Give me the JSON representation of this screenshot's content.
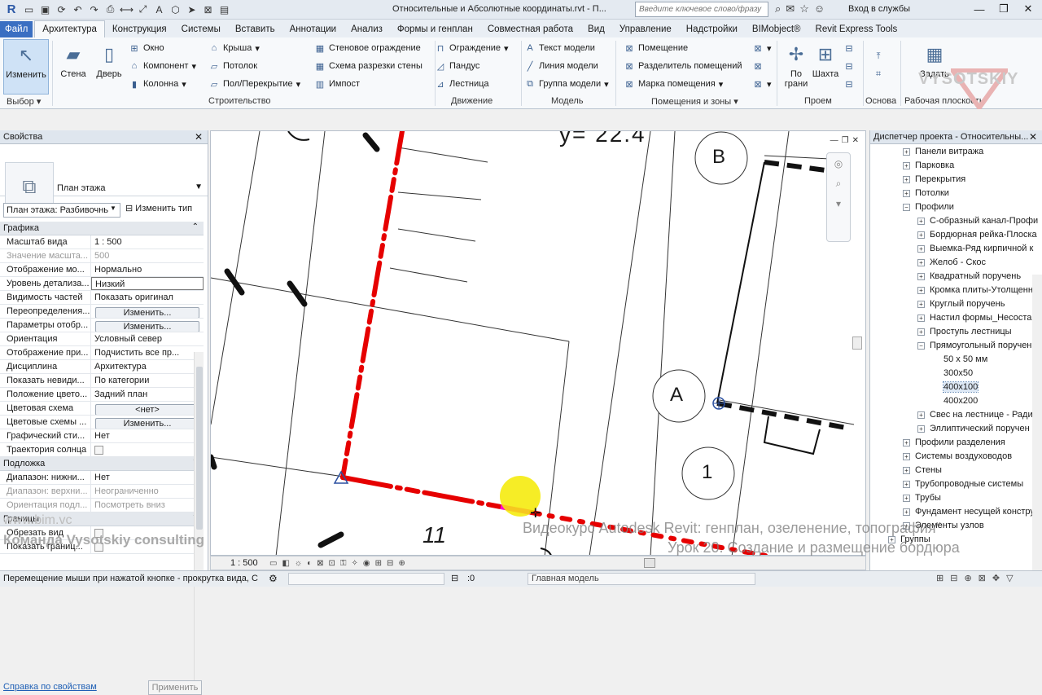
{
  "titlebar": {
    "logo": "R",
    "document_title": "Относительные и Абсолютные координаты.rvt - П...",
    "search_placeholder": "Введите ключевое слово/фразу",
    "signin": "Вход в службы"
  },
  "tabs": [
    "Файл",
    "Архитектура",
    "Конструкция",
    "Системы",
    "Вставить",
    "Аннотации",
    "Анализ",
    "Формы и генплан",
    "Совместная работа",
    "Вид",
    "Управление",
    "Надстройки",
    "BIMobject®",
    "Revit Express Tools"
  ],
  "ribbon": {
    "modify": "Изменить",
    "wall": "Стена",
    "door": "Дверь",
    "window": "Окно",
    "component": "Компонент",
    "column": "Колонна",
    "roof": "Крыша",
    "ceiling": "Потолок",
    "floor": "Пол/Перекрытие",
    "curtain_wall": "Стеновое ограждение",
    "curtain_grid": "Схема разрезки стены",
    "mullion": "Импост",
    "railing": "Ограждение",
    "ramp": "Пандус",
    "stair": "Лестница",
    "model_text": "Текст модели",
    "model_line": "Линия модели",
    "model_group": "Группа модели",
    "room": "Помещение",
    "room_sep": "Разделитель помещений",
    "room_tag": "Марка помещения",
    "by_face": "По грани",
    "shaft": "Шахта",
    "set": "Задать",
    "groups": {
      "select": "Выбор",
      "build": "Строительство",
      "circulation": "Движение",
      "model": "Модель",
      "rooms": "Помещения и зоны",
      "opening": "Проем",
      "datum": "Основа",
      "workplane": "Рабочая плоскость"
    },
    "watermark": "VYSOTSKIY"
  },
  "properties": {
    "title": "Свойства",
    "type_name": "План этажа",
    "view_selector": "План этажа: Разбивочнь",
    "edit_type": "Изменить тип",
    "sections": {
      "graphics": "Графика",
      "underlay": "Подложка",
      "extents": "Границы"
    },
    "rows": [
      {
        "k": "Масштаб вида",
        "v": "1 : 500"
      },
      {
        "k": "Значение масшта...",
        "v": "500",
        "dim": true
      },
      {
        "k": "Отображение мо...",
        "v": "Нормально"
      },
      {
        "k": "Уровень детализа...",
        "v": "Низкий"
      },
      {
        "k": "Видимость частей",
        "v": "Показать оригинал"
      },
      {
        "k": "Переопределения...",
        "btn": "Изменить..."
      },
      {
        "k": "Параметры отобр...",
        "btn": "Изменить..."
      },
      {
        "k": "Ориентация",
        "v": "Условный север"
      },
      {
        "k": "Отображение при...",
        "v": "Подчистить все пр..."
      },
      {
        "k": "Дисциплина",
        "v": "Архитектура"
      },
      {
        "k": "Показать невиди...",
        "v": "По категории"
      },
      {
        "k": "Положение цвето...",
        "v": "Задний план"
      },
      {
        "k": "Цветовая схема",
        "btn": "<нет>"
      },
      {
        "k": "Цветовые схемы ...",
        "btn": "Изменить..."
      },
      {
        "k": "Графический сти...",
        "v": "Нет"
      },
      {
        "k": "Траектория солнца",
        "chk": true
      }
    ],
    "underlay_rows": [
      {
        "k": "Диапазон: нижни...",
        "v": "Нет"
      },
      {
        "k": "Диапазон: верхни...",
        "v": "Неограниченно",
        "dim": true
      },
      {
        "k": "Ориентация подл...",
        "v": "Посмотреть вниз",
        "dim": true
      }
    ],
    "extent_rows": [
      {
        "k": "Обрезать вид",
        "chk": true
      },
      {
        "k": "Показать границ...",
        "chk": true
      }
    ],
    "help_link": "Справка по свойствам",
    "apply": "Применить"
  },
  "canvas": {
    "grid_b": "B",
    "grid_a": "A",
    "grid_1": "1",
    "label_11": "11",
    "coord_text": "y= 22.4"
  },
  "viewbar": {
    "scale": "1 : 500"
  },
  "browser": {
    "title": "Диспетчер проекта - Относительны...",
    "items": [
      {
        "t": "Панели витража",
        "lvl": 1,
        "ex": "+"
      },
      {
        "t": "Парковка",
        "lvl": 1,
        "ex": "+"
      },
      {
        "t": "Перекрытия",
        "lvl": 1,
        "ex": "+"
      },
      {
        "t": "Потолки",
        "lvl": 1,
        "ex": "+"
      },
      {
        "t": "Профили",
        "lvl": 1,
        "ex": "-"
      },
      {
        "t": "С-образный канал-Профи",
        "lvl": 2,
        "ex": "+"
      },
      {
        "t": "Бордюрная рейка-Плоска",
        "lvl": 2,
        "ex": "+"
      },
      {
        "t": "Выемка-Ряд кирпичной к",
        "lvl": 2,
        "ex": "+"
      },
      {
        "t": "Желоб - Скос",
        "lvl": 2,
        "ex": "+"
      },
      {
        "t": "Квадратный поручень",
        "lvl": 2,
        "ex": "+"
      },
      {
        "t": "Кромка плиты-Утолщенна",
        "lvl": 2,
        "ex": "+"
      },
      {
        "t": "Круглый поручень",
        "lvl": 2,
        "ex": "+"
      },
      {
        "t": "Настил формы_Несостан",
        "lvl": 2,
        "ex": "+"
      },
      {
        "t": "Проступь лестницы",
        "lvl": 2,
        "ex": "+"
      },
      {
        "t": "Прямоугольный поручен",
        "lvl": 2,
        "ex": "-"
      },
      {
        "t": "50 x 50 мм",
        "lvl": 3
      },
      {
        "t": "300x50",
        "lvl": 3
      },
      {
        "t": "400x100",
        "lvl": 3,
        "sel": true
      },
      {
        "t": "400x200",
        "lvl": 3
      },
      {
        "t": "Свес на лестнице - Радиу",
        "lvl": 2,
        "ex": "+"
      },
      {
        "t": "Эллиптический поручен",
        "lvl": 2,
        "ex": "+"
      },
      {
        "t": "Профили разделения",
        "lvl": 1,
        "ex": "+"
      },
      {
        "t": "Системы воздуховодов",
        "lvl": 1,
        "ex": "+"
      },
      {
        "t": "Стены",
        "lvl": 1,
        "ex": "+"
      },
      {
        "t": "Трубопроводные системы",
        "lvl": 1,
        "ex": "+"
      },
      {
        "t": "Трубы",
        "lvl": 1,
        "ex": "+"
      },
      {
        "t": "Фундамент несущей констру",
        "lvl": 1,
        "ex": "+"
      },
      {
        "t": "Элементы узлов",
        "lvl": 1,
        "ex": "+"
      },
      {
        "t": "Группы",
        "lvl": 0,
        "ex": "+"
      }
    ]
  },
  "statusbar": {
    "hint": "Перемещение мыши при нажатой кнопке - прокрутка вида, С",
    "value": ":0",
    "model": "Главная модель"
  },
  "overlays": {
    "site": "www.bim.vc",
    "team": "Команда Vysotskiy consulting",
    "course": "Видеокурс Autodesk Revit: генплан, озеленение, топография\"",
    "lesson": "Урок 20. Создание и размещение бордюра"
  }
}
